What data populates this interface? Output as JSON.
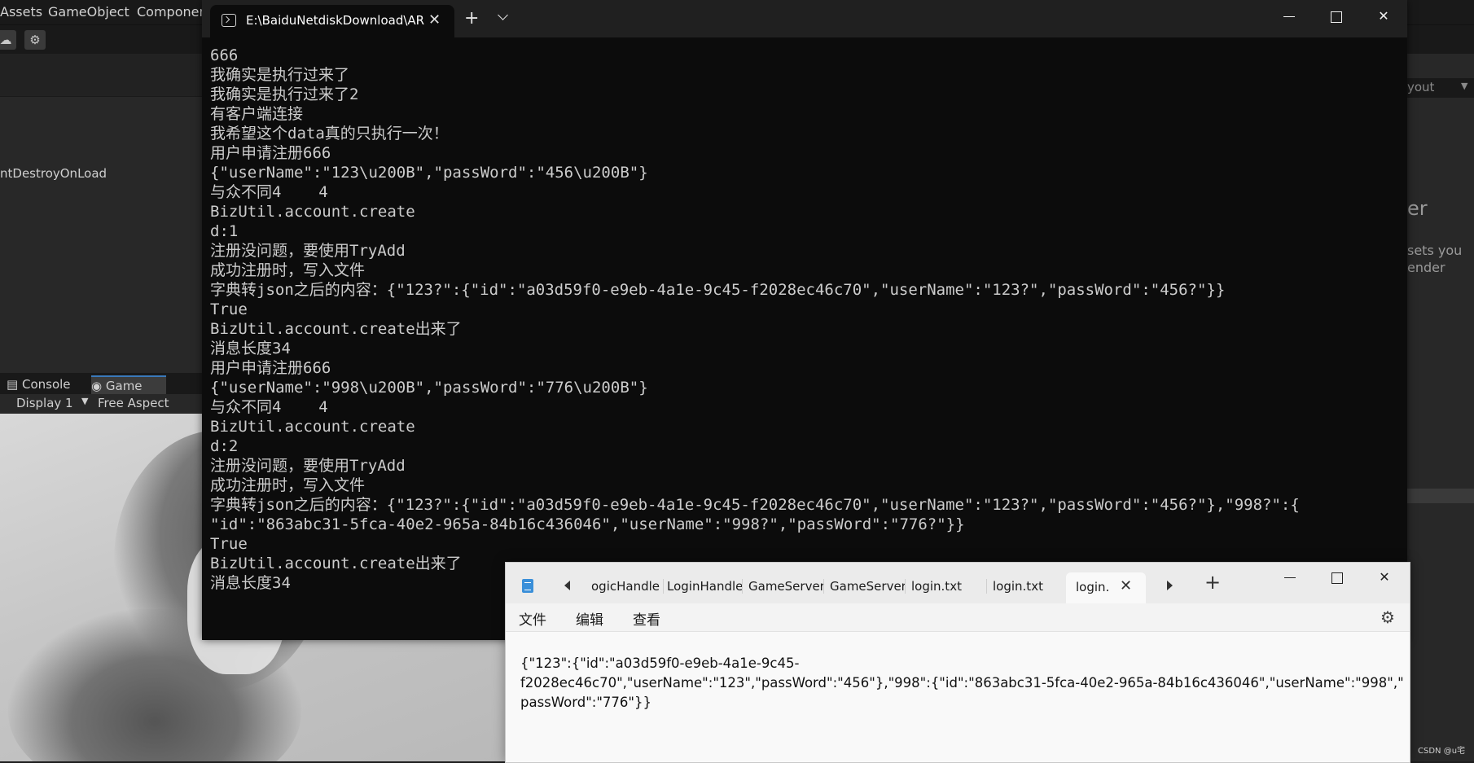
{
  "unity": {
    "menu": [
      "Assets",
      "GameObject",
      "Componen"
    ],
    "hierarchy_item": "ntDestroyOnLoad",
    "tabs": [
      "Console",
      "Game"
    ],
    "display": "Display 1",
    "aspect": "Free Aspect",
    "layout_label": "yout",
    "right_heading": "er",
    "right_text": [
      "sets you",
      "ender"
    ]
  },
  "terminal": {
    "tab_title": "E:\\BaiduNetdiskDownload\\AR",
    "lines": [
      "666",
      "我确实是执行过来了",
      "我确实是执行过来了2",
      "有客户端连接",
      "我希望这个data真的只执行一次！",
      "用户申请注册666",
      "{\"userName\":\"123\\u200B\",\"passWord\":\"456\\u200B\"}",
      "与众不同4    4",
      "BizUtil.account.create",
      "d:1",
      "注册没问题，要使用TryAdd",
      "成功注册时，写入文件",
      "字典转json之后的内容：{\"123?\":{\"id\":\"a03d59f0-e9eb-4a1e-9c45-f2028ec46c70\",\"userName\":\"123?\",\"passWord\":\"456?\"}}",
      "True",
      "BizUtil.account.create出来了",
      "消息长度34",
      "用户申请注册666",
      "{\"userName\":\"998\\u200B\",\"passWord\":\"776\\u200B\"}",
      "与众不同4    4",
      "BizUtil.account.create",
      "d:2",
      "注册没问题，要使用TryAdd",
      "成功注册时，写入文件",
      "字典转json之后的内容：{\"123?\":{\"id\":\"a03d59f0-e9eb-4a1e-9c45-f2028ec46c70\",\"userName\":\"123?\",\"passWord\":\"456?\"},\"998?\":{",
      "\"id\":\"863abc31-5fca-40e2-965a-84b16c436046\",\"userName\":\"998?\",\"passWord\":\"776?\"}}",
      "True",
      "BizUtil.account.create出来了",
      "消息长度34"
    ]
  },
  "notepad": {
    "tabs": [
      "ogicHandle",
      "LoginHandle",
      "GameServer.",
      "GameServer.",
      "login.txt",
      "login.txt"
    ],
    "active_tab": "login.",
    "menu": [
      "文件",
      "编辑",
      "查看"
    ],
    "content": [
      "{\"123\":{\"id\":\"a03d59f0-e9eb-4a1e-9c45-",
      "f2028ec46c70\",\"userName\":\"123\",\"passWord\":\"456\"},\"998\":{\"id\":\"863abc31-5fca-40e2-965a-84b16c436046\",\"userName\":\"998\",\"",
      "passWord\":\"776\"}}"
    ]
  },
  "watermark": "CSDN @u宅"
}
